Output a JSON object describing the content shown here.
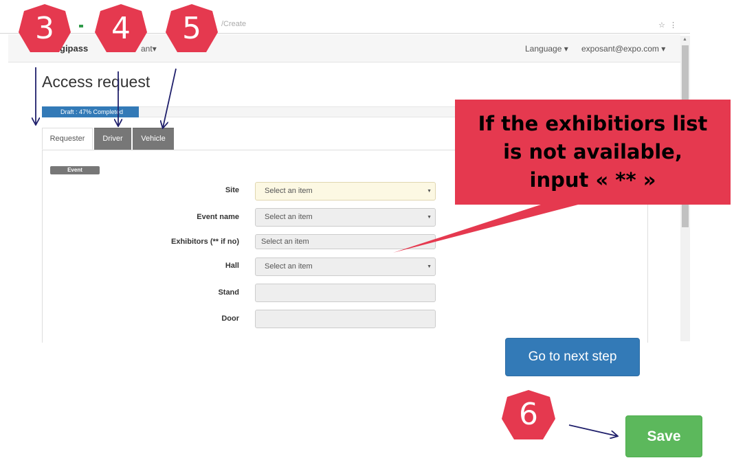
{
  "browser": {
    "url_fragment": "/Create"
  },
  "navbar": {
    "brand": "gipass",
    "exposant_menu": "ant",
    "language_menu": "Language",
    "user_menu": "exposant@expo.com"
  },
  "page": {
    "title": "Access request",
    "progress": {
      "text": "Draft : 47% Completed",
      "percent": 47
    },
    "tabs": [
      "Requester",
      "Driver",
      "Vehicle"
    ],
    "section_badge": "Event"
  },
  "form": {
    "rows": [
      {
        "label": "Site",
        "value": "Select an item",
        "dropdown": true
      },
      {
        "label": "Event name",
        "value": "Select an item",
        "dropdown": true
      },
      {
        "label": "Exhibitors (** if no)",
        "value": "Select an item",
        "dropdown": false
      },
      {
        "label": "Hall",
        "value": "Select an item",
        "dropdown": true
      },
      {
        "label": "Stand",
        "value": "",
        "dropdown": false
      },
      {
        "label": "Door",
        "value": "",
        "dropdown": false
      }
    ]
  },
  "callout": {
    "lines": [
      "If the exhibitiors list",
      "is not available,",
      "input « ** »"
    ],
    "color": "#e5394f"
  },
  "buttons": {
    "next": "Go to next step",
    "save": "Save"
  },
  "steps": [
    "3",
    "4",
    "5",
    "6"
  ],
  "colors": {
    "step_marker": "#e5394f",
    "primary": "#337ab7",
    "success": "#5cb85c",
    "arrow": "#1f1f6b"
  },
  "icons": {
    "caret": "caret-down-icon",
    "arrow": "pointer-arrow-icon"
  }
}
